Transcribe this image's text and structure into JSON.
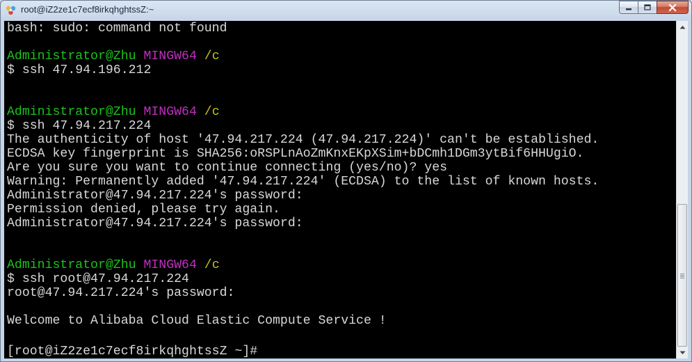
{
  "window": {
    "title": "root@iZ2ze1c7ecf8irkqhghtssZ:~",
    "app_icon": "git-bash-icon",
    "buttons": {
      "minimize": "minimize-icon",
      "maximize": "maximize-icon",
      "close": "close-icon"
    }
  },
  "colors": {
    "terminal_bg": "#000000",
    "text": "#d8d8d8",
    "user_host": "#1cc21c",
    "shell_name": "#c02ec0",
    "path": "#c6c51c"
  },
  "terminal": {
    "lines": [
      {
        "text": "bash: sudo: command not found"
      },
      {
        "text": ""
      },
      {
        "prompt": {
          "user": "Administrator@Zhu",
          "shell": "MINGW64",
          "path": "/c"
        }
      },
      {
        "text": "$ ssh 47.94.196.212"
      },
      {
        "text": ""
      },
      {
        "text": ""
      },
      {
        "prompt": {
          "user": "Administrator@Zhu",
          "shell": "MINGW64",
          "path": "/c"
        }
      },
      {
        "text": "$ ssh 47.94.217.224"
      },
      {
        "text": "The authenticity of host '47.94.217.224 (47.94.217.224)' can't be established."
      },
      {
        "text": "ECDSA key fingerprint is SHA256:oRSPLnAoZmKnxEKpXSim+bDCmh1DGm3ytBif6HHUgiO."
      },
      {
        "text": "Are you sure you want to continue connecting (yes/no)? yes"
      },
      {
        "text": "Warning: Permanently added '47.94.217.224' (ECDSA) to the list of known hosts."
      },
      {
        "text": "Administrator@47.94.217.224's password:"
      },
      {
        "text": "Permission denied, please try again."
      },
      {
        "text": "Administrator@47.94.217.224's password:"
      },
      {
        "text": ""
      },
      {
        "text": ""
      },
      {
        "prompt": {
          "user": "Administrator@Zhu",
          "shell": "MINGW64",
          "path": "/c"
        }
      },
      {
        "text": "$ ssh root@47.94.217.224"
      },
      {
        "text": "root@47.94.217.224's password:"
      },
      {
        "text": ""
      },
      {
        "text": "Welcome to Alibaba Cloud Elastic Compute Service !"
      },
      {
        "text": ""
      },
      {
        "text": "[root@iZ2ze1c7ecf8irkqhghtssZ ~]#"
      }
    ]
  },
  "scrollbar": {
    "up_icon": "scroll-up-arrow-icon",
    "down_icon": "scroll-down-arrow-icon",
    "position": 1.0
  }
}
